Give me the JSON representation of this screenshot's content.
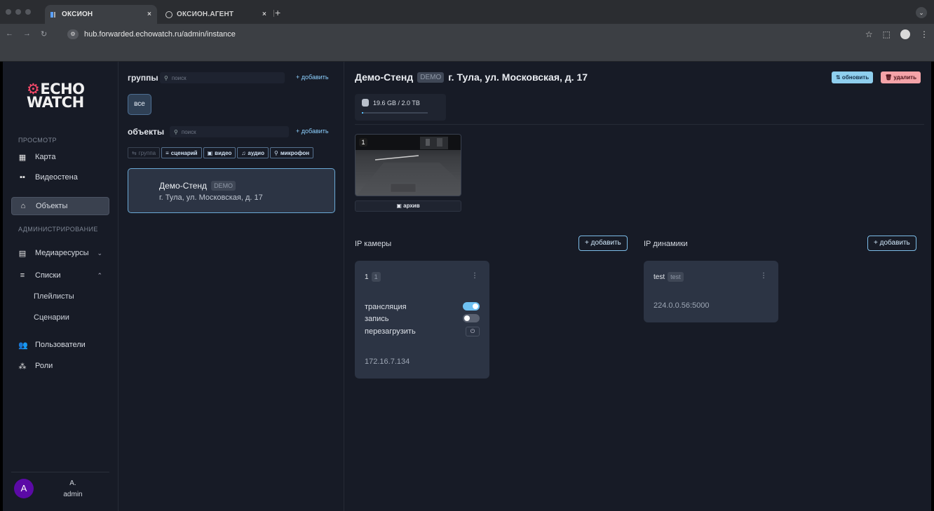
{
  "browser": {
    "tabs": [
      {
        "title": "ОКСИОН",
        "active": true
      },
      {
        "title": "ОКСИОН.АГЕНТ",
        "active": false
      }
    ],
    "url": "hub.forwarded.echowatch.ru/admin/instance",
    "close_glyph": "×",
    "new_tab_glyph": "+"
  },
  "sidebar": {
    "logo_line1": "ECHO",
    "logo_line2": "WATCH",
    "section_view": "ПРОСМОТР",
    "items_view": [
      {
        "label": "Карта",
        "icon": "map-icon"
      },
      {
        "label": "Видеостена",
        "icon": "grid-icon"
      },
      {
        "label": "Объекты",
        "icon": "home-icon",
        "active": true
      }
    ],
    "section_admin": "АДМИНИСТРИРОВАНИЕ",
    "items_admin": [
      {
        "label": "Медиаресурсы",
        "icon": "film-icon",
        "chevron": "⌄"
      },
      {
        "label": "Списки",
        "icon": "list-icon",
        "chevron": "⌃"
      }
    ],
    "sub_items": [
      "Плейлисты",
      "Сценарии"
    ],
    "items_users": [
      {
        "label": "Пользователи",
        "icon": "users-icon"
      },
      {
        "label": "Роли",
        "icon": "roles-icon"
      }
    ],
    "user": {
      "initial": "A",
      "name": "A.",
      "role": "admin"
    }
  },
  "list_panel": {
    "groups_title": "группы",
    "groups_search_placeholder": "поиск",
    "groups_add": "+ добавить",
    "all_button": "все",
    "objects_title": "объекты",
    "objects_search_placeholder": "поиск",
    "objects_add": "+ добавить",
    "filters": [
      {
        "label": "группа",
        "icon": "⇆",
        "enabled": false
      },
      {
        "label": "сценарий",
        "icon": "≡",
        "enabled": true
      },
      {
        "label": "видео",
        "icon": "▣",
        "enabled": true
      },
      {
        "label": "аудио",
        "icon": "♫",
        "enabled": true
      },
      {
        "label": "микрофон",
        "icon": "🎙",
        "enabled": true
      }
    ],
    "object": {
      "name": "Демо-Стенд",
      "badge": "DEMO",
      "address": "г. Тула, ул. Московская, д. 17"
    }
  },
  "detail": {
    "title": "Демо-Стенд",
    "badge": "DEMO",
    "address": "г. Тула, ул. Московская, д. 17",
    "refresh_label": "⇅ обновить",
    "delete_label": "🗑 удалить",
    "storage_text": "19.6 GB / 2.0 TB",
    "storage_used_fraction": 0.0098,
    "camera_thumb_number": "1",
    "archive_label": "архив",
    "cameras_title": "IP камеры",
    "cameras_add": "+ добавить",
    "speakers_title": "IP динамики",
    "speakers_add": "+ добавить",
    "camera_card": {
      "name": "1",
      "badge": "1",
      "kebab": "⋮",
      "rows": [
        {
          "label": "трансляция",
          "toggle": true
        },
        {
          "label": "запись",
          "toggle": false
        },
        {
          "label": "перезагрузить",
          "action": "power-icon"
        }
      ],
      "ip": "172.16.7.134"
    },
    "speaker_card": {
      "name": "test",
      "badge": "test",
      "kebab": "⋮",
      "address": "224.0.0.56:5000"
    }
  }
}
